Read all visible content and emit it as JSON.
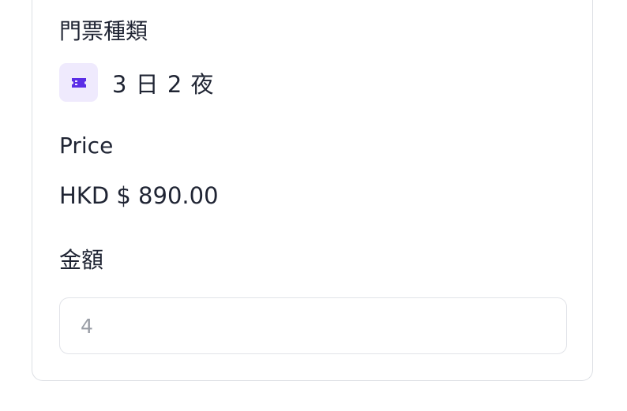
{
  "ticket": {
    "section_label": "門票種類",
    "type_text": "3 日 2 夜",
    "icon": "ticket-icon",
    "icon_color": "#5b2ee6",
    "badge_bg": "#efeafd"
  },
  "price": {
    "label": "Price",
    "value": "HKD $ 890.00"
  },
  "amount": {
    "label": "金額",
    "input_value": "4"
  }
}
